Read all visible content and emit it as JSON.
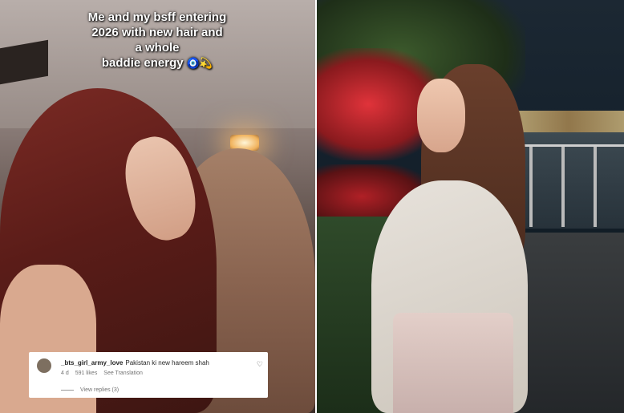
{
  "caption": {
    "line1": "Me and my bsff entering",
    "line2": "2026 with new hair and",
    "line3": "a whole",
    "line4": "baddie energy",
    "emoji": "🧿💫"
  },
  "comment": {
    "username": "_bts_girl_army_love",
    "text": "Pakistan ki new hareem shah",
    "age": "4 d",
    "likes": "591 likes",
    "translate": "See Translation",
    "replies": "View replies (3)"
  },
  "icons": {
    "like": "heart-icon",
    "avatar": "avatar"
  },
  "colors": {
    "divider": "#ffffff",
    "caption_text": "#ffffff",
    "comment_bg": "#ffffff"
  }
}
